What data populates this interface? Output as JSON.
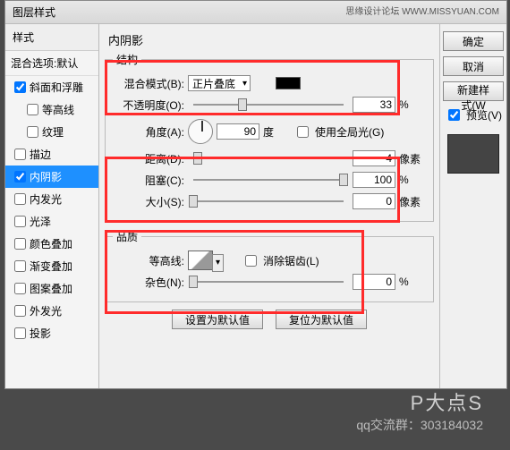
{
  "title": "图层样式",
  "sponsor": "思缘设计论坛 WWW.MISSYUAN.COM",
  "left": {
    "head": "样式",
    "blend": "混合选项:默认",
    "items": [
      {
        "label": "斜面和浮雕",
        "checked": true
      },
      {
        "label": "等高线",
        "checked": false,
        "indent": true
      },
      {
        "label": "纹理",
        "checked": false,
        "indent": true
      },
      {
        "label": "描边",
        "checked": false
      },
      {
        "label": "内阴影",
        "checked": true,
        "selected": true
      },
      {
        "label": "内发光",
        "checked": false
      },
      {
        "label": "光泽",
        "checked": false
      },
      {
        "label": "颜色叠加",
        "checked": false
      },
      {
        "label": "渐变叠加",
        "checked": false
      },
      {
        "label": "图案叠加",
        "checked": false
      },
      {
        "label": "外发光",
        "checked": false
      },
      {
        "label": "投影",
        "checked": false
      }
    ]
  },
  "panel": {
    "title": "内阴影",
    "structure": {
      "legend": "结构",
      "blend_label": "混合模式(B):",
      "blend_value": "正片叠底",
      "opacity_label": "不透明度(O):",
      "opacity_value": "33",
      "opacity_unit": "%",
      "angle_label": "角度(A):",
      "angle_value": "90",
      "angle_unit": "度",
      "global_label": "使用全局光(G)",
      "distance_label": "距离(D):",
      "distance_value": "4",
      "distance_unit": "像素",
      "choke_label": "阻塞(C):",
      "choke_value": "100",
      "choke_unit": "%",
      "size_label": "大小(S):",
      "size_value": "0",
      "size_unit": "像素"
    },
    "quality": {
      "legend": "品质",
      "contour_label": "等高线:",
      "aa_label": "消除锯齿(L)",
      "noise_label": "杂色(N):",
      "noise_value": "0",
      "noise_unit": "%"
    },
    "btn_default": "设置为默认值",
    "btn_reset": "复位为默认值"
  },
  "right": {
    "ok": "确定",
    "cancel": "取消",
    "newstyle": "新建样式(W",
    "preview": "预览(V)"
  },
  "watermark": {
    "l1": "P大点S",
    "l2": "qq交流群：303184032"
  }
}
